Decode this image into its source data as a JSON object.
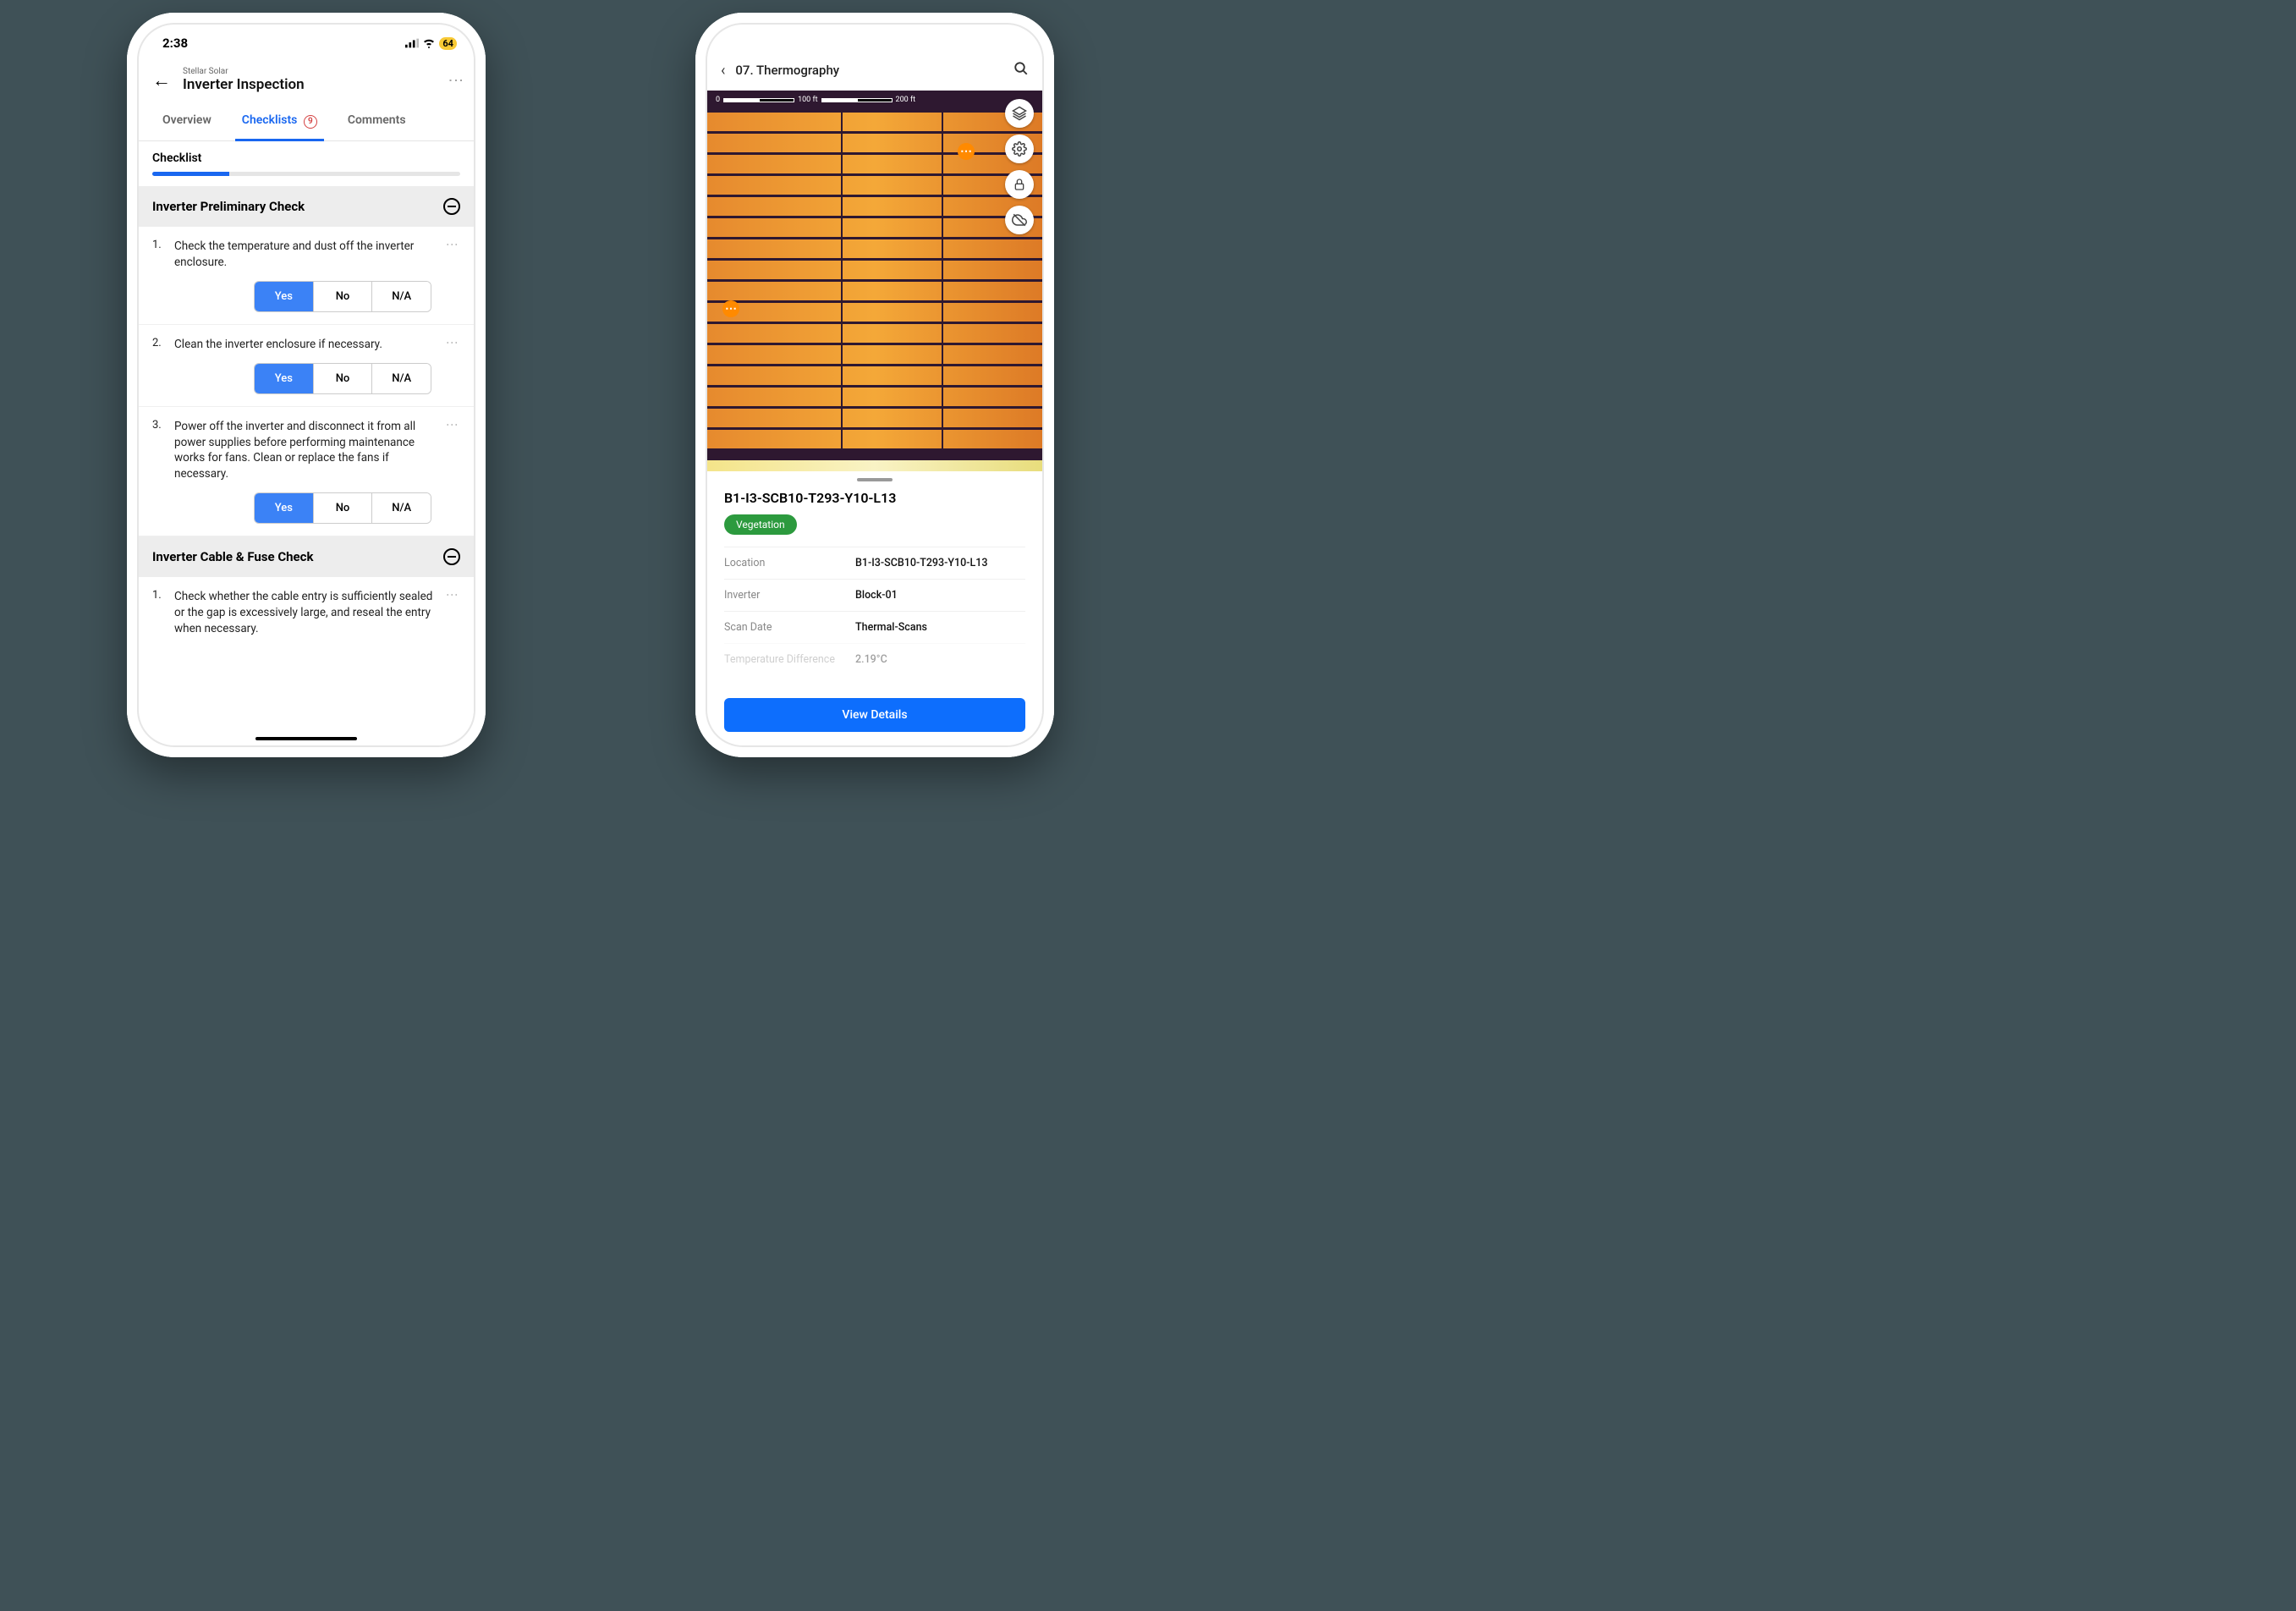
{
  "phone1": {
    "status": {
      "time": "2:38",
      "battery": "64"
    },
    "header": {
      "org": "Stellar Solar",
      "title": "Inverter Inspection"
    },
    "tabs": {
      "overview": "Overview",
      "checklists": "Checklists",
      "checklists_badge": "9",
      "comments": "Comments"
    },
    "progress": {
      "label": "Checklist",
      "pct": 25
    },
    "sections": [
      {
        "title": "Inverter Preliminary Check",
        "items": [
          {
            "num": "1.",
            "text": "Check the temperature and dust off the inverter enclosure.",
            "yes": "Yes",
            "no": "No",
            "na": "N/A",
            "sel": "yes"
          },
          {
            "num": "2.",
            "text": "Clean the inverter enclosure if necessary.",
            "yes": "Yes",
            "no": "No",
            "na": "N/A",
            "sel": "yes"
          },
          {
            "num": "3.",
            "text": "Power off the inverter and disconnect it from all power supplies before performing maintenance works for fans. Clean or replace the fans if necessary.",
            "yes": "Yes",
            "no": "No",
            "na": "N/A",
            "sel": "yes"
          }
        ]
      },
      {
        "title": "Inverter Cable & Fuse Check",
        "items": [
          {
            "num": "1.",
            "text": "Check whether the cable entry is sufficiently sealed or the gap is excessively large, and reseal the entry when necessary."
          }
        ]
      }
    ]
  },
  "phone2": {
    "header": {
      "title": "07. Thermography"
    },
    "scale": {
      "zero": "0",
      "mid": "100 ft",
      "far": "200 ft"
    },
    "detail": {
      "id": "B1-I3-SCB10-T293-Y10-L13",
      "badge": "Vegetation",
      "rows": [
        {
          "key": "Location",
          "val": "B1-I3-SCB10-T293-Y10-L13"
        },
        {
          "key": "Inverter",
          "val": "Block-01"
        },
        {
          "key": "Scan Date",
          "val": "Thermal-Scans"
        },
        {
          "key": "Temperature Difference",
          "val": "2.19°C"
        }
      ],
      "button": "View Details"
    }
  }
}
